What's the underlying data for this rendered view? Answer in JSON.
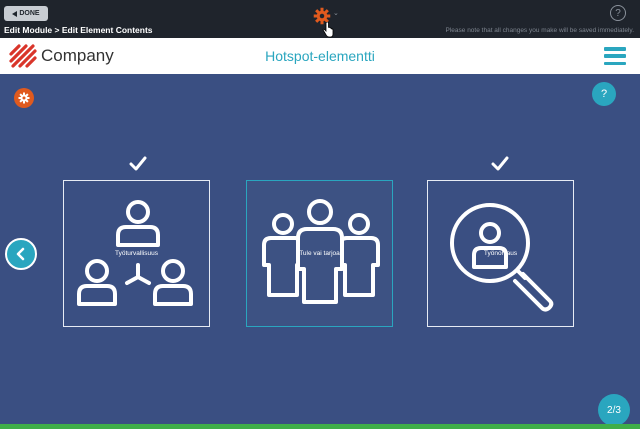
{
  "editor": {
    "done_label": "DONE",
    "breadcrumb": "Edit Module > Edit Element Contents",
    "save_notice": "Please note that all changes you make will be saved immediately.",
    "help_label": "?"
  },
  "module": {
    "company_name": "Company",
    "title": "Hotspot-elementti",
    "help_label": "?",
    "page_indicator": "2/3"
  },
  "cards": [
    {
      "label": "Työturvallisuus",
      "icon": "hierarchy-icon",
      "checked": true
    },
    {
      "label": "Tule vai tarjoa",
      "icon": "team-icon",
      "checked": false
    },
    {
      "label": "Työnohjaus",
      "icon": "search-person-icon",
      "checked": true
    }
  ],
  "colors": {
    "accent": "#2aa6bf",
    "background": "#3a4f82",
    "orange": "#e05a1e",
    "logo": "#d9352a",
    "green": "#3fae49"
  }
}
